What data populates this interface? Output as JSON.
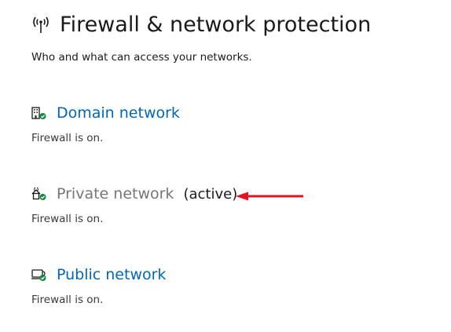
{
  "header": {
    "title": "Firewall & network protection",
    "subtitle": "Who and what can access your networks.",
    "icon": "wireless-signal-icon"
  },
  "networks": [
    {
      "name": "Domain network",
      "status": "Firewall is on.",
      "icon": "domain-building-icon",
      "active": false
    },
    {
      "name": "Private network",
      "active_label": "(active)",
      "status": "Firewall is on.",
      "icon": "private-home-icon",
      "active": true
    },
    {
      "name": "Public network",
      "status": "Firewall is on.",
      "icon": "public-cafe-icon",
      "active": false
    }
  ],
  "colors": {
    "link": "#0067b8",
    "muted": "#767676",
    "check": "#10893e",
    "annotation_arrow": "#e81123"
  }
}
